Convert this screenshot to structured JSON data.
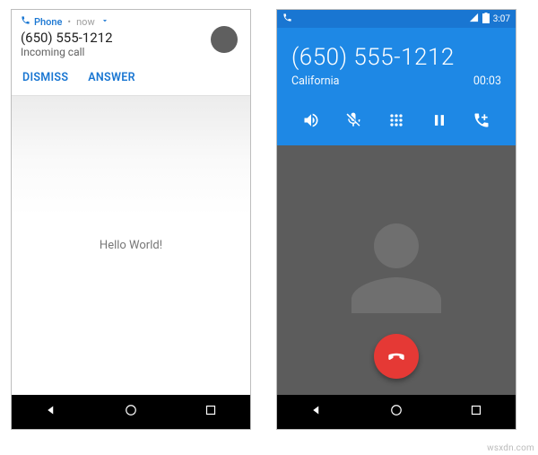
{
  "left": {
    "notification": {
      "app_icon": "phone-icon",
      "app_name": "Phone",
      "time": "now",
      "number": "(650) 555-1212",
      "subtitle": "Incoming call",
      "expand_icon": "chevron-down-icon"
    },
    "actions": {
      "dismiss": "DISMISS",
      "answer": "ANSWER"
    },
    "content_text": "Hello World!"
  },
  "right": {
    "statusbar": {
      "left_icon": "phone-icon",
      "signal_icon": "signal-icon",
      "battery_icon": "battery-icon",
      "clock": "3:07"
    },
    "call": {
      "number": "(650) 555-1212",
      "location": "California",
      "duration": "00:03"
    },
    "controls": {
      "speaker": "speaker-icon",
      "mute": "mute-icon",
      "dialpad": "dialpad-icon",
      "hold": "pause-icon",
      "add_call": "add-call-icon"
    },
    "end_call_icon": "hangup-icon"
  },
  "nav": {
    "back": "back-icon",
    "home": "home-icon",
    "recent": "recent-icon"
  },
  "watermark": "wsxdn.com"
}
